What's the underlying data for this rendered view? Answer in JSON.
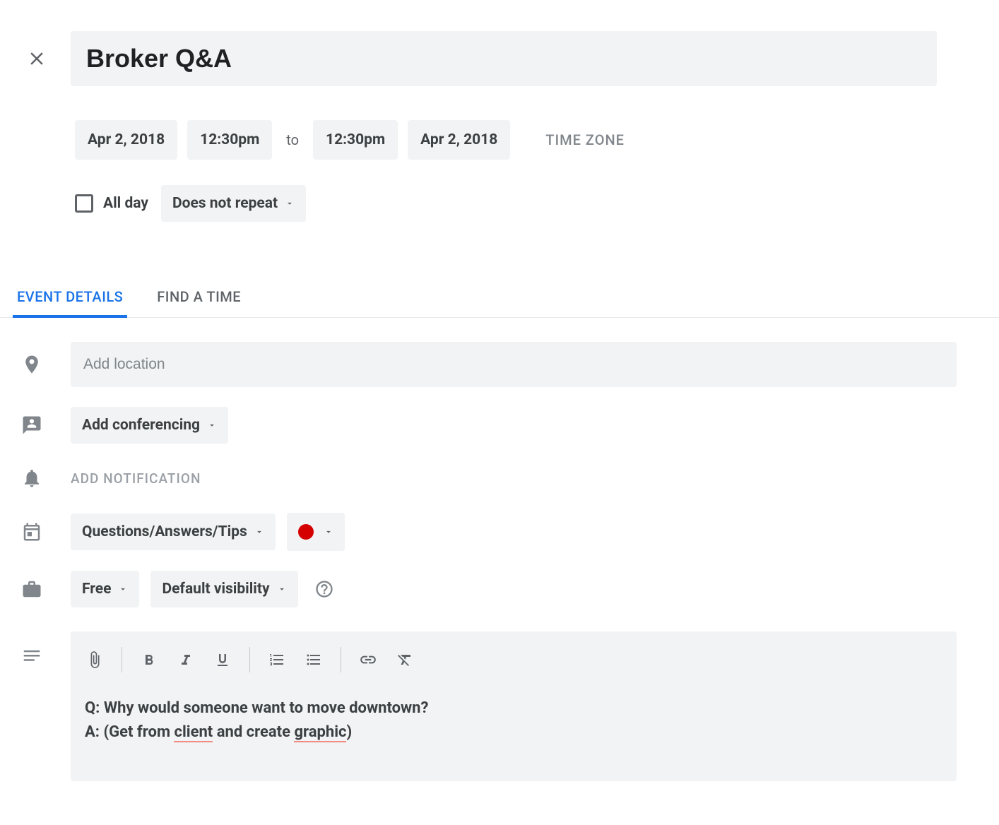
{
  "header": {
    "title": "Broker Q&A"
  },
  "datetime": {
    "start_date": "Apr 2, 2018",
    "start_time": "12:30pm",
    "to_label": "to",
    "end_time": "12:30pm",
    "end_date": "Apr 2, 2018",
    "timezone_label": "TIME ZONE",
    "all_day_label": "All day",
    "repeat": "Does not repeat"
  },
  "tabs": {
    "event_details": "EVENT DETAILS",
    "find_a_time": "FIND A TIME"
  },
  "details": {
    "location_placeholder": "Add location",
    "conferencing": "Add conferencing",
    "notification": "ADD NOTIFICATION",
    "calendar": "Questions/Answers/Tips",
    "color": "#d50000",
    "availability": "Free",
    "visibility": "Default visibility"
  },
  "description": {
    "q_label": "Q:",
    "q_text": "Why would someone want to move downtown?",
    "a_label": "A:",
    "a_prefix": "(Get from ",
    "a_word1": "client",
    "a_mid": " and create ",
    "a_word2": "graphic",
    "a_suffix": ")"
  }
}
